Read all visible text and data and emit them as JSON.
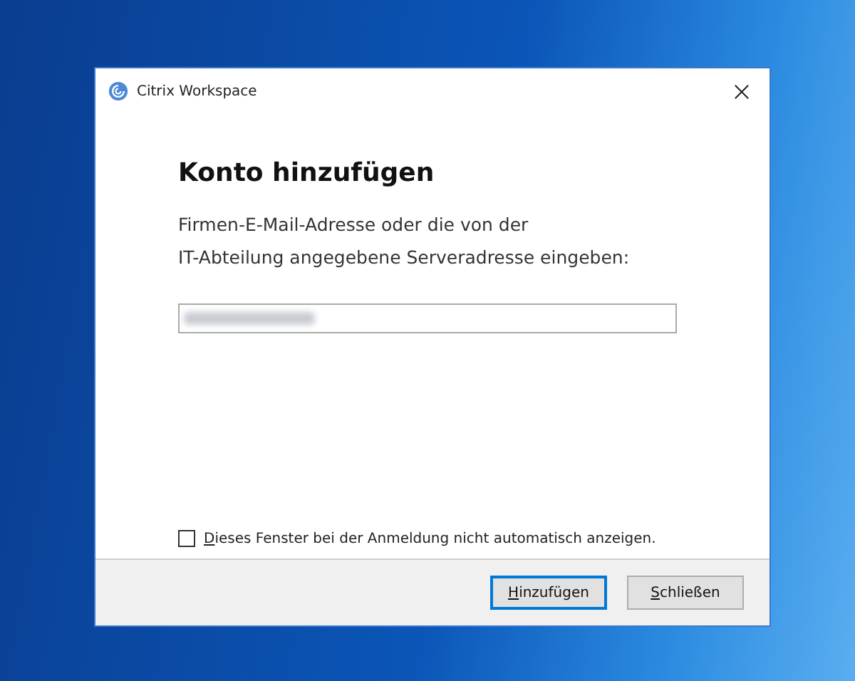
{
  "window": {
    "title": "Citrix Workspace"
  },
  "heading": "Konto hinzufügen",
  "description": [
    "Firmen-E-Mail-Adresse oder die von der",
    "IT-Abteilung angegebene Serveradresse eingeben:"
  ],
  "checkbox": {
    "label": "Dieses Fenster bei der Anmeldung nicht automatisch anzeigen.",
    "checked": false
  },
  "buttons": [
    {
      "label": "Hinzufügen",
      "default": true
    },
    {
      "label": "Schließen",
      "default": false
    }
  ]
}
